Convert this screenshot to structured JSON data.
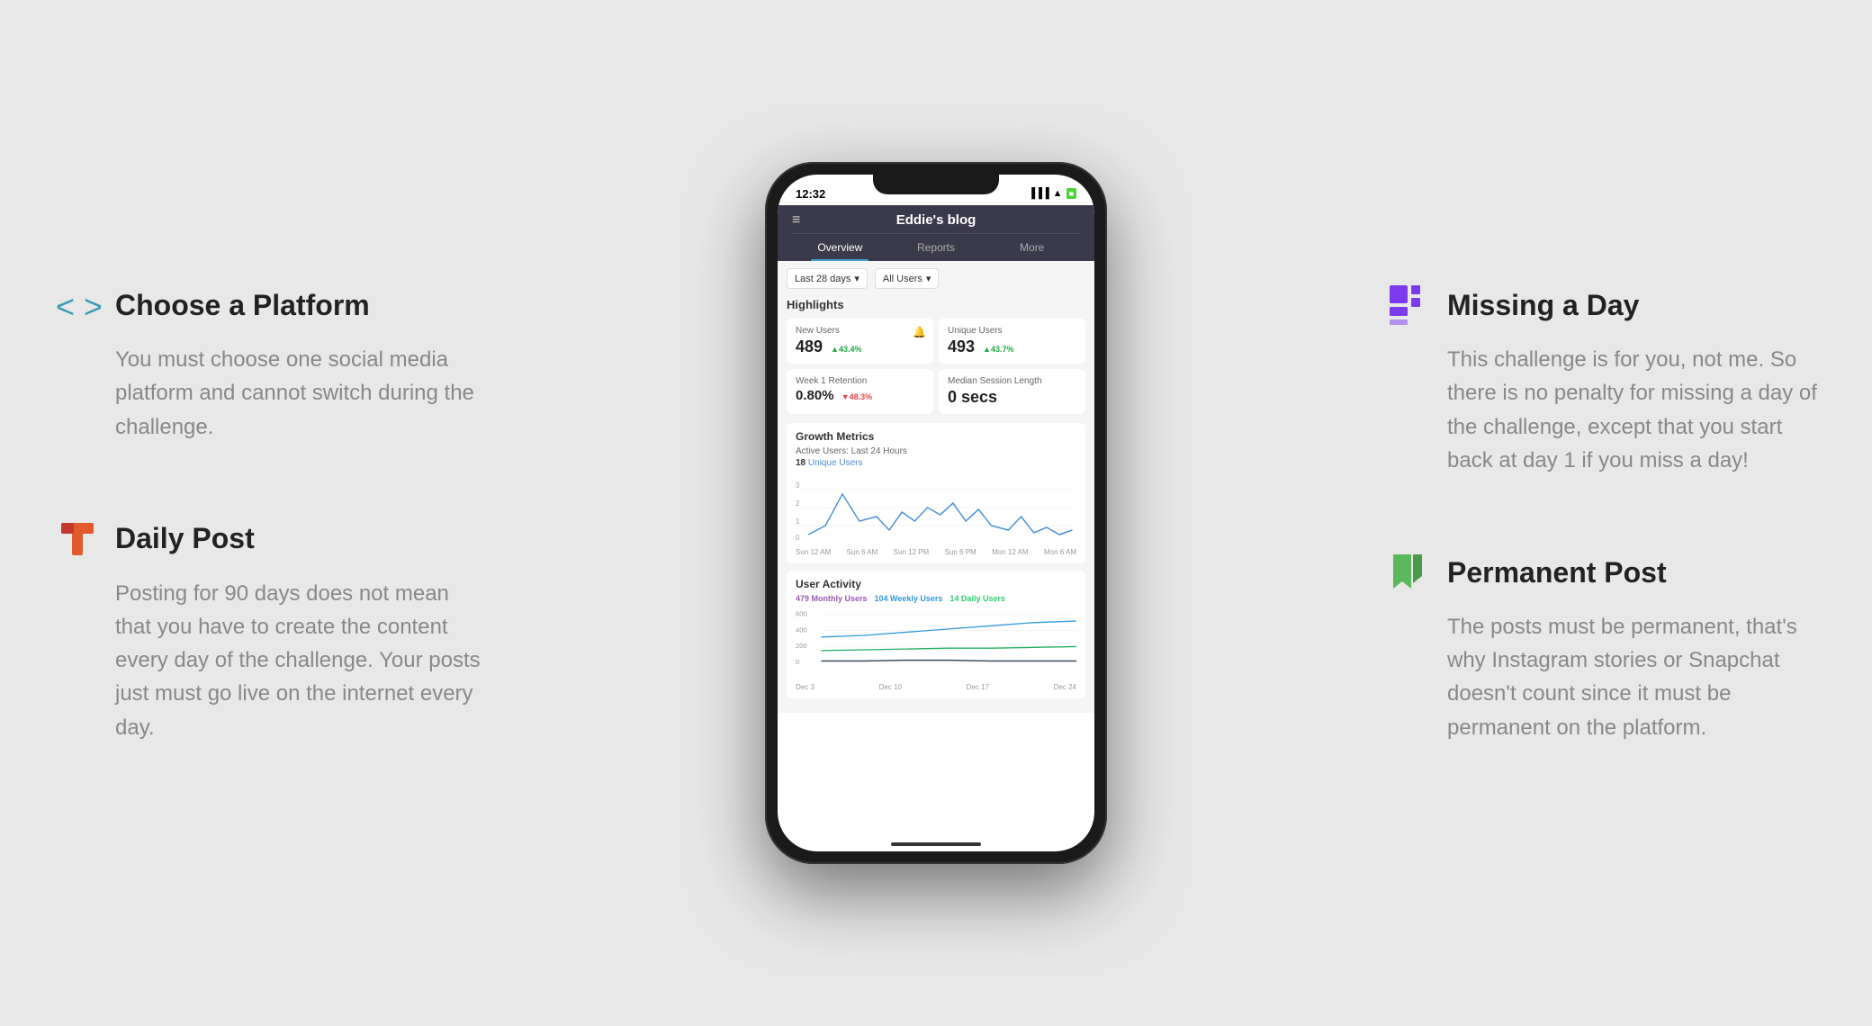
{
  "left": {
    "block1": {
      "title": "Choose a Platform",
      "desc": "You must choose one social media platform and cannot switch during the challenge.",
      "icon_type": "code"
    },
    "block2": {
      "title": "Daily Post",
      "desc": "Posting for 90 days does not mean that you have to create the content every day of the challenge. Your posts just must go live on the internet every day.",
      "icon_type": "daily"
    }
  },
  "right": {
    "block1": {
      "title": "Missing a Day",
      "desc": "This challenge is for you, not me. So there is no penalty for missing a day of the challenge, except that you start back at day 1 if you miss a day!",
      "icon_type": "missing"
    },
    "block2": {
      "title": "Permanent Post",
      "desc": "The posts must be permanent, that's why Instagram stories or Snapchat doesn't count since it must be permanent on the platform.",
      "icon_type": "permanent"
    }
  },
  "phone": {
    "status_time": "12:32",
    "app_title": "Eddie's blog",
    "tabs": [
      "Overview",
      "Reports",
      "More"
    ],
    "active_tab": "Overview",
    "filter_period": "Last 28 days",
    "filter_users": "All Users",
    "highlights_title": "Highlights",
    "highlights": [
      {
        "label": "New Users",
        "value": "489",
        "change": "43.4%",
        "direction": "up"
      },
      {
        "label": "Unique Users",
        "value": "493",
        "change": "43.7%",
        "direction": "up"
      },
      {
        "label": "Week 1 Retention",
        "value": "0.80%",
        "change": "48.3%",
        "direction": "down"
      },
      {
        "label": "Median Session Length",
        "value": "0 secs",
        "change": "",
        "direction": ""
      }
    ],
    "growth_title": "Growth Metrics",
    "active_users_title": "Active Users: Last 24 Hours",
    "active_count": "18",
    "active_label": "Unique Users",
    "chart_x_labels": [
      "Sun 12 AM",
      "Sun 6 AM",
      "Sun 12 PM",
      "Sun 6 PM",
      "Mon 12 AM",
      "Mon 6 AM"
    ],
    "activity_title": "User Activity",
    "monthly_count": "479",
    "weekly_count": "104",
    "daily_count": "14",
    "monthly_label": "Monthly Users",
    "weekly_label": "Weekly Users",
    "daily_label": "Daily Users",
    "activity_x_labels": [
      "Dec 3",
      "Dec 10",
      "Dec 17",
      "Dec 24"
    ],
    "activity_y_labels": [
      "600",
      "400",
      "200",
      "0"
    ]
  }
}
